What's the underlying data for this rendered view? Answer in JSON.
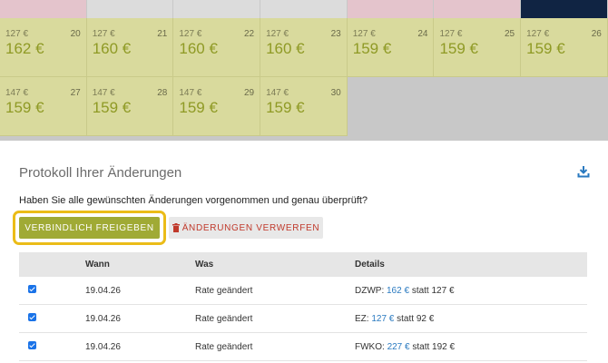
{
  "calendar": {
    "header_colors": [
      "#e4c4cc",
      "#dcdcdc",
      "#dcdcdc",
      "#dcdcdc",
      "#e4c4cc",
      "#e4c4cc",
      "#102443"
    ],
    "row1": [
      {
        "orig": "127 €",
        "day": "20",
        "price": "162 €"
      },
      {
        "orig": "127 €",
        "day": "21",
        "price": "160 €"
      },
      {
        "orig": "127 €",
        "day": "22",
        "price": "160 €"
      },
      {
        "orig": "127 €",
        "day": "23",
        "price": "160 €"
      },
      {
        "orig": "127 €",
        "day": "24",
        "price": "159 €"
      },
      {
        "orig": "127 €",
        "day": "25",
        "price": "159 €"
      },
      {
        "orig": "127 €",
        "day": "26",
        "price": "159 €"
      }
    ],
    "row2": [
      {
        "orig": "147 €",
        "day": "27",
        "price": "159 €"
      },
      {
        "orig": "147 €",
        "day": "28",
        "price": "159 €"
      },
      {
        "orig": "147 €",
        "day": "29",
        "price": "159 €"
      },
      {
        "orig": "147 €",
        "day": "30",
        "price": "159 €"
      }
    ]
  },
  "log": {
    "title": "Protokoll Ihrer Änderungen",
    "question": "Haben Sie alle gewünschten Änderungen vorgenommen und genau überprüft?",
    "approve_label": "VERBINDLICH FREIGEBEN",
    "discard_label": "ÄNDERUNGEN VERWERFEN",
    "columns": [
      "",
      "Wann",
      "Was",
      "Details"
    ],
    "rows": [
      {
        "date": "19.04.26",
        "what": "Rate geändert",
        "code": "DZWP:",
        "new_price": "162 €",
        "rest": "statt 127 €"
      },
      {
        "date": "19.04.26",
        "what": "Rate geändert",
        "code": "EZ:",
        "new_price": "127 €",
        "rest": "statt 92 €"
      },
      {
        "date": "19.04.26",
        "what": "Rate geändert",
        "code": "FWKO:",
        "new_price": "227 €",
        "rest": "statt 192 €"
      }
    ]
  }
}
